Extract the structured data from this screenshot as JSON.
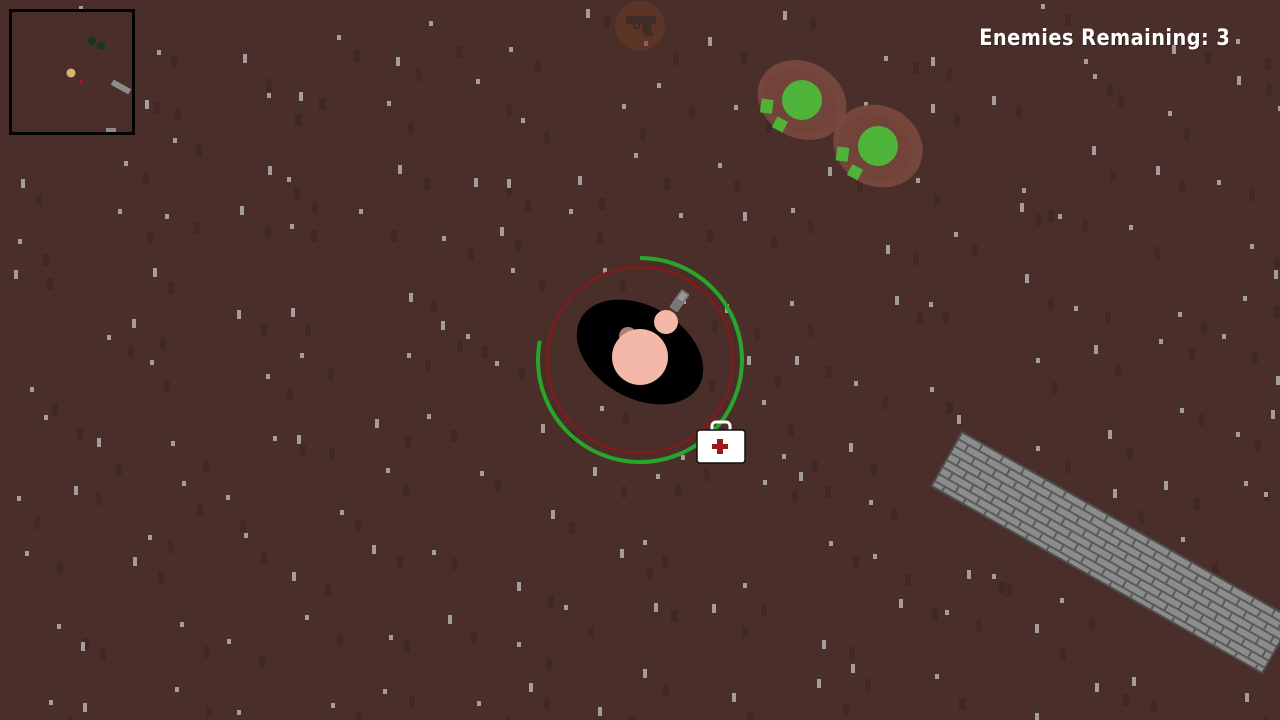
{
  "hud": {
    "enemies_label": "Enemies Remaining:",
    "enemies_count": "3"
  },
  "player": {
    "health_fraction": 0.78,
    "weapon": "pistol"
  },
  "minimap": {
    "markers": [
      "enemy",
      "enemy",
      "player",
      "wall"
    ]
  },
  "entities": {
    "enemies": 2,
    "pickups": [
      "health-pack",
      "pistol"
    ],
    "walls": 1
  },
  "colors": {
    "ground": "#4a2e2a",
    "ground_speck": "#a39d9b",
    "ground_dark_speck": "#3d2522",
    "zombie_body": "#7a4a3e",
    "zombie_head": "#4fb33a",
    "health_ring": "#2aa52a",
    "health_ring_bg": "#7b1e1e",
    "skin": "#f3b8a8",
    "brick": "#8c8c8c",
    "brick_mortar": "#5a5a5a"
  }
}
